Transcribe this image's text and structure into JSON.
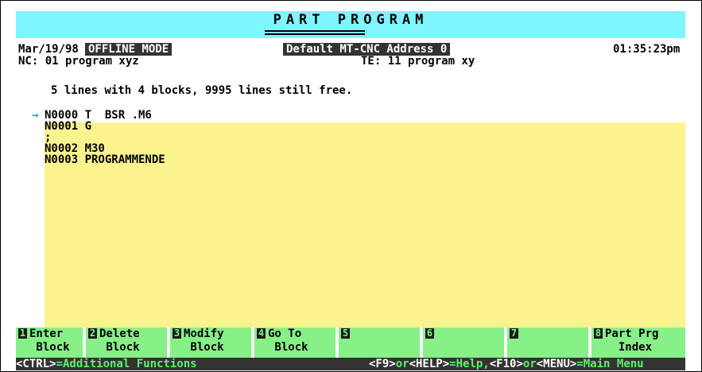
{
  "title": "PART PROGRAM",
  "header": {
    "date": "Mar/19/98",
    "mode": "OFFLINE MODE",
    "machine": "Default MT-CNC Address 0",
    "time": "01:35:23pm",
    "nc": "NC: 01 program xyz",
    "te": "TE: 11 program xy"
  },
  "info": "5 lines with 4 blocks, 9995 lines still free.",
  "cursor_glyph": "→",
  "program_lines": [
    "N0000 T  BSR .M6",
    "N0001 G",
    ";",
    "N0002 M30",
    "N0003 PROGRAMMENDE"
  ],
  "fkeys": [
    {
      "num": "1",
      "line1": "Enter",
      "line2": " Block"
    },
    {
      "num": "2",
      "line1": "Delete",
      "line2": " Block"
    },
    {
      "num": "3",
      "line1": "Modify",
      "line2": " Block"
    },
    {
      "num": "4",
      "line1": "Go To",
      "line2": " Block"
    },
    {
      "num": "5",
      "line1": "",
      "line2": ""
    },
    {
      "num": "6",
      "line1": "",
      "line2": ""
    },
    {
      "num": "7",
      "line1": "",
      "line2": ""
    },
    {
      "num": "8",
      "line1": "Part Prg",
      "line2": "  Index"
    }
  ],
  "status": {
    "ctrl_key": "<CTRL>",
    "ctrl_text": "=Additional Functions",
    "f9": "<F9>",
    "or1": "or",
    "help_key": "<HELP>",
    "help_text": "=Help,",
    "f10": "<F10>",
    "or2": "or",
    "menu_key": "<MENU>",
    "menu_text": "=Main Menu"
  },
  "colors": {
    "title_bg": "#7ff5ff",
    "editor_bg": "#fbf48e",
    "fkey_bg": "#87f087",
    "status_bg": "#333333",
    "status_highlight": "#5ff06a",
    "cursor": "#1a9fff"
  }
}
